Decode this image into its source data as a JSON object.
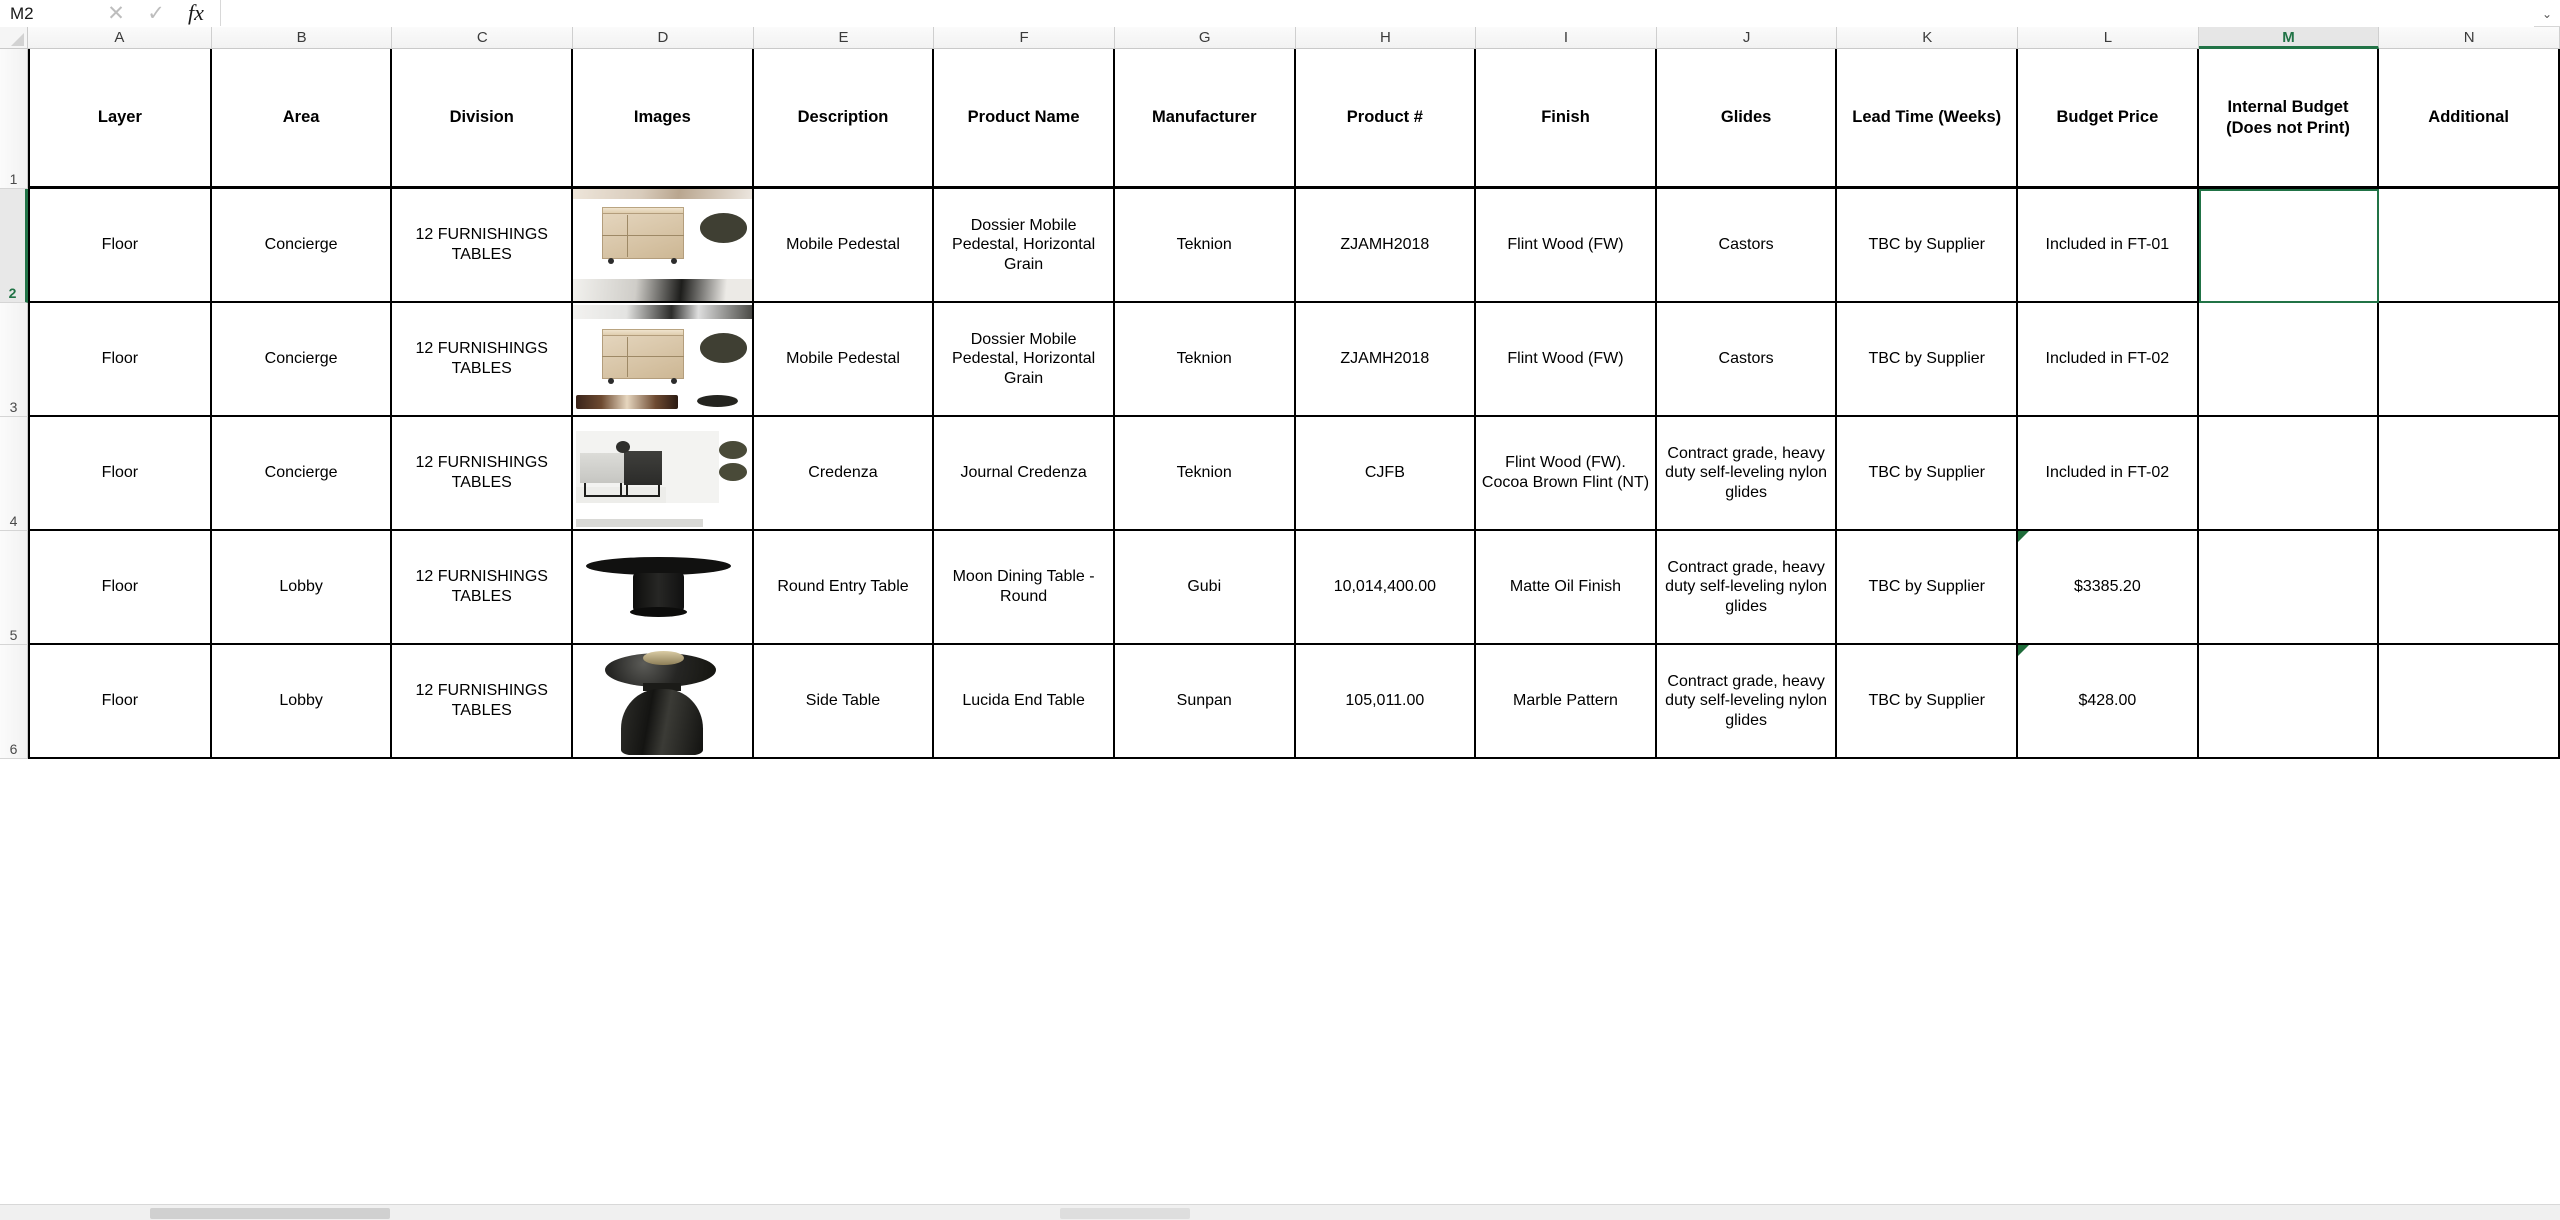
{
  "formula_bar": {
    "name_box_value": "M2",
    "formula_value": "",
    "formula_placeholder": "",
    "cancel_label": "✕",
    "accept_label": "✓",
    "function_label": "fx",
    "expand_label": "⌄"
  },
  "grid": {
    "active_cell": "M2",
    "active_column": "M",
    "active_row": "2",
    "column_letters": [
      "A",
      "B",
      "C",
      "D",
      "E",
      "F",
      "G",
      "H",
      "I",
      "J",
      "K",
      "L",
      "M",
      "N"
    ],
    "row_numbers": [
      "1",
      "2",
      "3",
      "4",
      "5",
      "6"
    ],
    "headers": [
      "Layer",
      "Area",
      "Division",
      "Images",
      "Description",
      "Product Name",
      "Manufacturer",
      "Product #",
      "Finish",
      "Glides",
      "Lead Time (Weeks)",
      "Budget Price",
      "Internal Budget (Does not Print)",
      "Additional"
    ],
    "header_m_line1": "Internal Budget",
    "header_m_line2": "(Does not Print)",
    "rows": [
      {
        "layer": "Floor",
        "area": "Concierge",
        "division": "12 FURNISHINGS TABLES",
        "image": "mobile-pedestal-wood",
        "description": "Mobile Pedestal",
        "product_name": "Dossier Mobile Pedestal, Horizontal Grain",
        "manufacturer": "Teknion",
        "product_number": "ZJAMH2018",
        "finish": "Flint Wood (FW)",
        "glides": "Castors",
        "lead_time": "TBC by Supplier",
        "budget_price": "Included in FT-01",
        "internal_budget": "",
        "additional": "",
        "has_comment": false
      },
      {
        "layer": "Floor",
        "area": "Concierge",
        "division": "12 FURNISHINGS TABLES",
        "image": "mobile-pedestal-wood",
        "description": "Mobile Pedestal",
        "product_name": "Dossier Mobile Pedestal, Horizontal Grain",
        "manufacturer": "Teknion",
        "product_number": "ZJAMH2018",
        "finish": "Flint Wood (FW)",
        "glides": "Castors",
        "lead_time": "TBC by Supplier",
        "budget_price": "Included in FT-02",
        "internal_budget": "",
        "additional": "",
        "has_comment": false
      },
      {
        "layer": "Floor",
        "area": "Concierge",
        "division": "12 FURNISHINGS TABLES",
        "image": "journal-credenza",
        "description": "Credenza",
        "product_name": "Journal Credenza",
        "manufacturer": "Teknion",
        "product_number": "CJFB",
        "finish": "Flint Wood (FW). Cocoa Brown Flint (NT)",
        "glides": "Contract grade, heavy duty self-leveling nylon glides",
        "lead_time": "TBC by Supplier",
        "budget_price": "Included in FT-02",
        "internal_budget": "",
        "additional": "",
        "has_comment": false
      },
      {
        "layer": "Floor",
        "area": "Lobby",
        "division": "12 FURNISHINGS TABLES",
        "image": "round-dining-table",
        "description": "Round Entry Table",
        "product_name": "Moon Dining Table - Round",
        "manufacturer": "Gubi",
        "product_number": "10,014,400.00",
        "finish": "Matte Oil Finish",
        "glides": "Contract grade, heavy duty self-leveling nylon glides",
        "lead_time": "TBC by Supplier",
        "budget_price": "$3385.20",
        "internal_budget": "",
        "additional": "",
        "has_comment": true
      },
      {
        "layer": "Floor",
        "area": "Lobby",
        "division": "12 FURNISHINGS TABLES",
        "image": "marble-side-table",
        "description": "Side Table",
        "product_name": "Lucida End Table",
        "manufacturer": "Sunpan",
        "product_number": "105,011.00",
        "finish": "Marble Pattern",
        "glides": "Contract grade, heavy duty self-leveling nylon glides",
        "lead_time": "TBC by Supplier",
        "budget_price": "$428.00",
        "internal_budget": "",
        "additional": "",
        "has_comment": true
      }
    ]
  },
  "colors": {
    "accent_green": "#217346",
    "grid_border": "#000000",
    "header_bg": "#f2f2f2"
  }
}
